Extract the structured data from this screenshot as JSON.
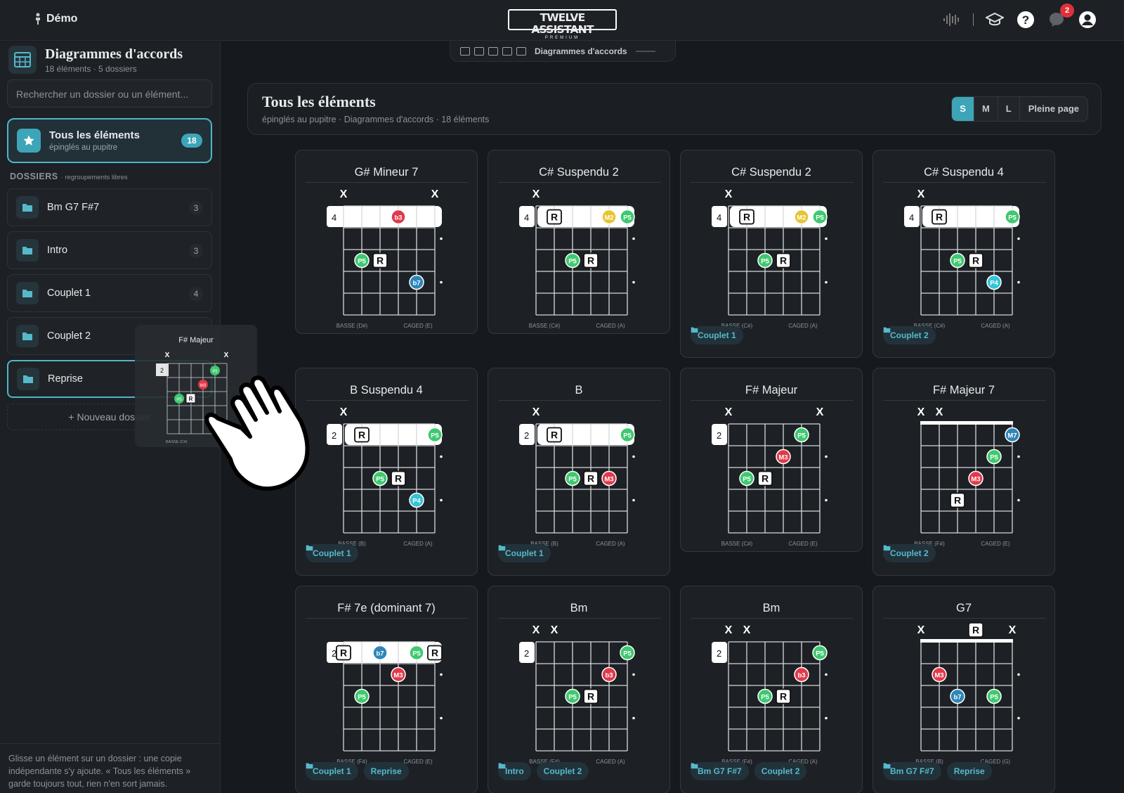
{
  "topbar": {
    "user": "Démo",
    "logo_main": "TWELVE ASSISTANT",
    "logo_sub": "PREMIUM",
    "notif_count": "2",
    "icons": [
      "waveform-icon",
      "graduation-cap-icon",
      "help-icon",
      "chat-icon",
      "user-icon"
    ]
  },
  "sidebar": {
    "title": "Diagrammes d'accords",
    "subtitle": "18 éléments · 5 dossiers",
    "search_placeholder": "Rechercher un dossier ou un élément...",
    "all": {
      "label": "Tous les éléments",
      "sub": "épinglés au pupitre",
      "count": "18"
    },
    "folders_heading": "DOSSIERS",
    "folders_hint": "· regroupements libres",
    "folders": [
      {
        "name": "Bm G7 F#7",
        "count": "3"
      },
      {
        "name": "Intro",
        "count": "3"
      },
      {
        "name": "Couplet 1",
        "count": "4"
      },
      {
        "name": "Couplet 2",
        "count": ""
      },
      {
        "name": "Reprise",
        "count": ""
      }
    ],
    "new_folder": "+ Nouveau dossier",
    "footer": "Glisse un élément sur un dossier : une copie indépendante s'y ajoute. « Tous les éléments » garde toujours tout, rien n'en sort jamais."
  },
  "breadcrumb": {
    "label": "Diagrammes d'accords"
  },
  "main": {
    "title": "Tous les éléments",
    "subtitle": "épinglés au pupitre · Diagrammes d'accords · 18 éléments",
    "sizes": [
      "S",
      "M",
      "L",
      "Pleine page"
    ],
    "active_size": "S"
  },
  "colors": {
    "P5": "#3ec96f",
    "R": "#ffffff",
    "b3": "#e03a4a",
    "M3": "#e03a4a",
    "b7": "#2e86b8",
    "M7": "#2e86b8",
    "P4": "#35c3d6",
    "M2": "#e8c431",
    "accent": "#3da5b8"
  },
  "drag_ghost": {
    "name": "F# Majeur",
    "fret": "2",
    "bass": "BASSE (C#)"
  },
  "chords": [
    {
      "name": "G# Mineur 7",
      "fret": "4",
      "muted": [
        0,
        5
      ],
      "barre": [
        0,
        5
      ],
      "dots": [
        [
          3,
          0,
          "b3"
        ],
        [
          1,
          2,
          "P5"
        ],
        [
          2,
          2,
          "R"
        ],
        [
          4,
          3,
          "b7"
        ]
      ],
      "bass": "BASSE (D#)",
      "caged": "CAGED (E)",
      "tags": []
    },
    {
      "name": "C# Suspendu 2",
      "fret": "4",
      "muted": [
        0
      ],
      "barre": [
        1,
        5
      ],
      "dots": [
        [
          1,
          0,
          "R"
        ],
        [
          4,
          0,
          "M2"
        ],
        [
          5,
          0,
          "P5"
        ],
        [
          2,
          2,
          "P5"
        ],
        [
          3,
          2,
          "R"
        ]
      ],
      "bass": "BASSE (C#)",
      "caged": "CAGED (A)",
      "tags": []
    },
    {
      "name": "C# Suspendu 2",
      "fret": "4",
      "muted": [
        0
      ],
      "barre": [
        1,
        5
      ],
      "dots": [
        [
          1,
          0,
          "R"
        ],
        [
          4,
          0,
          "M2"
        ],
        [
          5,
          0,
          "P5"
        ],
        [
          2,
          2,
          "P5"
        ],
        [
          3,
          2,
          "R"
        ]
      ],
      "bass": "BASSE (C#)",
      "caged": "CAGED (A)",
      "tags": [
        "Couplet 1"
      ]
    },
    {
      "name": "C# Suspendu 4",
      "fret": "4",
      "muted": [
        0
      ],
      "barre": [
        1,
        5
      ],
      "dots": [
        [
          1,
          0,
          "R"
        ],
        [
          5,
          0,
          "P5"
        ],
        [
          2,
          2,
          "P5"
        ],
        [
          3,
          2,
          "R"
        ],
        [
          4,
          3,
          "P4"
        ]
      ],
      "bass": "BASSE (C#)",
      "caged": "CAGED (A)",
      "tags": [
        "Couplet 2"
      ]
    },
    {
      "name": "B Suspendu 4",
      "fret": "2",
      "muted": [
        0
      ],
      "barre": [
        1,
        5
      ],
      "dots": [
        [
          1,
          0,
          "R"
        ],
        [
          5,
          0,
          "P5"
        ],
        [
          2,
          2,
          "P5"
        ],
        [
          3,
          2,
          "R"
        ],
        [
          4,
          3,
          "P4"
        ]
      ],
      "bass": "BASSE (B)",
      "caged": "CAGED (A)",
      "tags": [
        "Couplet 1"
      ]
    },
    {
      "name": "B",
      "fret": "2",
      "muted": [
        0
      ],
      "barre": [
        1,
        5
      ],
      "dots": [
        [
          1,
          0,
          "R"
        ],
        [
          5,
          0,
          "P5"
        ],
        [
          2,
          2,
          "P5"
        ],
        [
          3,
          2,
          "R"
        ],
        [
          4,
          2,
          "M3"
        ]
      ],
      "bass": "BASSE (B)",
      "caged": "CAGED (A)",
      "tags": [
        "Couplet 1"
      ]
    },
    {
      "name": "F# Majeur",
      "fret": "2",
      "muted": [
        0,
        5
      ],
      "barre": null,
      "dots": [
        [
          4,
          0,
          "P5"
        ],
        [
          3,
          1,
          "M3"
        ],
        [
          1,
          2,
          "P5"
        ],
        [
          2,
          2,
          "R"
        ]
      ],
      "bass": "BASSE (C#)",
      "caged": "CAGED (E)",
      "tags": []
    },
    {
      "name": "F# Majeur 7",
      "fret": "",
      "muted": [
        0,
        1
      ],
      "barre": null,
      "nut": true,
      "dots": [
        [
          5,
          0,
          "M7"
        ],
        [
          4,
          1,
          "P5"
        ],
        [
          3,
          2,
          "M3"
        ],
        [
          2,
          3,
          "R"
        ]
      ],
      "bass": "BASSE (F#)",
      "caged": "CAGED (E)",
      "tags": [
        "Couplet 2"
      ]
    },
    {
      "name": "F# 7e (dominant 7)",
      "fret": "2",
      "muted": [],
      "barre": [
        0,
        5
      ],
      "dots": [
        [
          0,
          0,
          "R"
        ],
        [
          2,
          0,
          "b7"
        ],
        [
          4,
          0,
          "P5"
        ],
        [
          5,
          0,
          "R"
        ],
        [
          3,
          1,
          "M3"
        ],
        [
          1,
          2,
          "P5"
        ]
      ],
      "bass": "BASSE (F#)",
      "caged": "CAGED (E)",
      "tags": [
        "Couplet 1",
        "Reprise"
      ]
    },
    {
      "name": "Bm",
      "fret": "2",
      "muted": [
        0,
        1
      ],
      "barre": null,
      "dots": [
        [
          5,
          0,
          "P5"
        ],
        [
          4,
          1,
          "b3"
        ],
        [
          2,
          2,
          "P5"
        ],
        [
          3,
          2,
          "R"
        ]
      ],
      "bass": "BASSE (F#)",
      "caged": "CAGED (A)",
      "tags": [
        "Intro",
        "Couplet 2"
      ]
    },
    {
      "name": "Bm",
      "fret": "2",
      "muted": [
        0,
        1
      ],
      "barre": null,
      "dots": [
        [
          5,
          0,
          "P5"
        ],
        [
          4,
          1,
          "b3"
        ],
        [
          2,
          2,
          "P5"
        ],
        [
          3,
          2,
          "R"
        ]
      ],
      "bass": "BASSE (F#)",
      "caged": "CAGED (A)",
      "tags": [
        "Bm G7 F#7",
        "Couplet 2"
      ]
    },
    {
      "name": "G7",
      "fret": "",
      "muted": [
        0,
        5
      ],
      "barre": null,
      "nut": true,
      "open_r": 3,
      "dots": [
        [
          1,
          1,
          "M3"
        ],
        [
          2,
          2,
          "b7"
        ],
        [
          4,
          2,
          "P5"
        ]
      ],
      "bass": "BASSE (B)",
      "caged": "CAGED (G)",
      "tags": [
        "Bm G7 F#7",
        "Reprise"
      ]
    }
  ]
}
